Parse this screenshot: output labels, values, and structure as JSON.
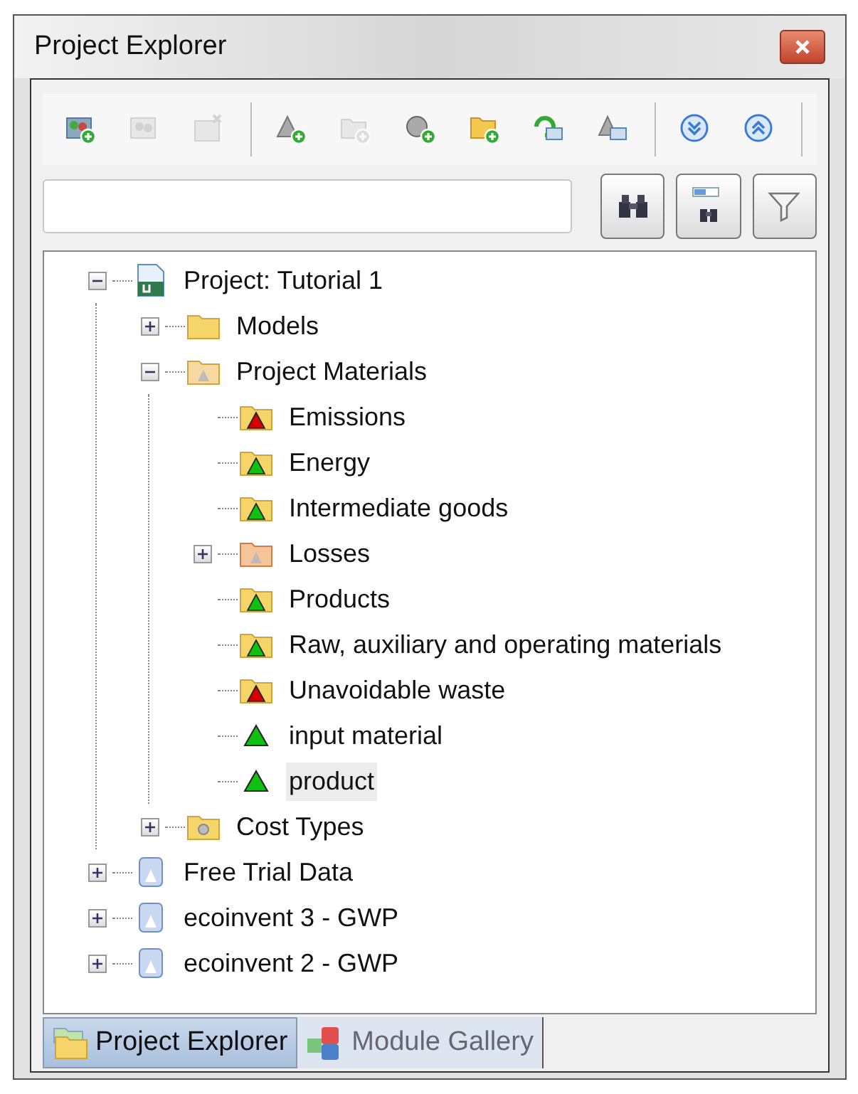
{
  "window": {
    "title": "Project Explorer"
  },
  "toolbar": [
    {
      "kind": "new-model",
      "disabled": false
    },
    {
      "kind": "model",
      "disabled": true
    },
    {
      "kind": "model-x",
      "disabled": true
    },
    {
      "kind": "separator"
    },
    {
      "kind": "material-add",
      "disabled": false
    },
    {
      "kind": "folder-add-gray",
      "disabled": true
    },
    {
      "kind": "cost-add",
      "disabled": false
    },
    {
      "kind": "folder-add",
      "disabled": false
    },
    {
      "kind": "refresh-list",
      "disabled": false
    },
    {
      "kind": "material-list",
      "disabled": false
    },
    {
      "kind": "separator"
    },
    {
      "kind": "expand-all",
      "disabled": false
    },
    {
      "kind": "collapse-all",
      "disabled": false
    },
    {
      "kind": "separator"
    }
  ],
  "search": {
    "search_buttons": [
      {
        "kind": "find"
      },
      {
        "kind": "find-in-list"
      },
      {
        "kind": "filter"
      }
    ]
  },
  "tree": [
    {
      "label": "Project: Tutorial 1",
      "kind": "project",
      "expanded": true,
      "selected": false,
      "children": [
        {
          "label": "Models",
          "kind": "folder",
          "expanded": false,
          "selected": false
        },
        {
          "label": "Project Materials",
          "kind": "folder-gray",
          "expanded": true,
          "selected": false,
          "children": [
            {
              "label": "Emissions",
              "kind": "folder-red",
              "selected": false
            },
            {
              "label": "Energy",
              "kind": "folder-green",
              "selected": false
            },
            {
              "label": "Intermediate goods",
              "kind": "folder-green",
              "selected": false
            },
            {
              "label": "Losses",
              "kind": "folder-orange",
              "expanded": false,
              "selected": false
            },
            {
              "label": "Products",
              "kind": "folder-green",
              "selected": false
            },
            {
              "label": "Raw, auxiliary and operating materials",
              "kind": "folder-green",
              "selected": false
            },
            {
              "label": "Unavoidable waste",
              "kind": "folder-red",
              "selected": false
            },
            {
              "label": "input material",
              "kind": "material",
              "selected": false
            },
            {
              "label": "product",
              "kind": "material",
              "selected": true
            }
          ]
        },
        {
          "label": "Cost Types",
          "kind": "folder-cost",
          "expanded": false,
          "selected": false
        }
      ]
    },
    {
      "label": "Free Trial Data",
      "kind": "database",
      "expanded": false,
      "selected": false
    },
    {
      "label": "ecoinvent 3 - GWP",
      "kind": "database",
      "expanded": false,
      "selected": false
    },
    {
      "label": "ecoinvent 2 - GWP",
      "kind": "database",
      "expanded": false,
      "selected": false
    }
  ],
  "tabs": [
    {
      "label": "Project Explorer",
      "kind": "folder",
      "selected": true
    },
    {
      "label": "Module Gallery",
      "kind": "cubes",
      "selected": false
    }
  ]
}
